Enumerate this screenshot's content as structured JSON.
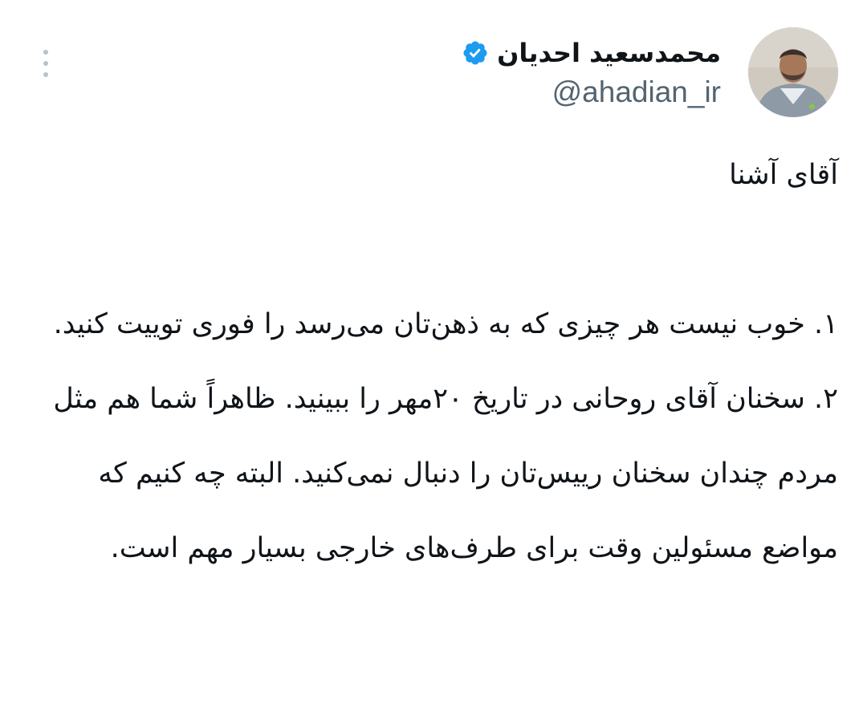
{
  "author": {
    "display_name": "محمدسعید احدیان",
    "handle": "@ahadian_ir",
    "verified": true,
    "verified_color": "#1d9bf0"
  },
  "tweet": {
    "greeting": "آقای آشنا",
    "paragraphs": [
      "۱. خوب نیست هر چیزی که به ذهن‌تان می‌رسد را فوری توییت کنید.",
      "۲. سخنان آقای روحانی در تاریخ ۲۰مهر را ببینید. ظاهراً شما هم مثل مردم چندان سخنان رییس‌تان را دنبال نمی‌کنید. البته چه کنیم که مواضع مسئولین وقت برای طرف‌های خارجی بسیار مهم است."
    ]
  },
  "icons": {
    "more": "more-vertical-icon",
    "verified": "verified-badge-icon"
  },
  "colors": {
    "text": "#0f1419",
    "secondary": "#536471",
    "more_dots": "#b8c2ca"
  }
}
